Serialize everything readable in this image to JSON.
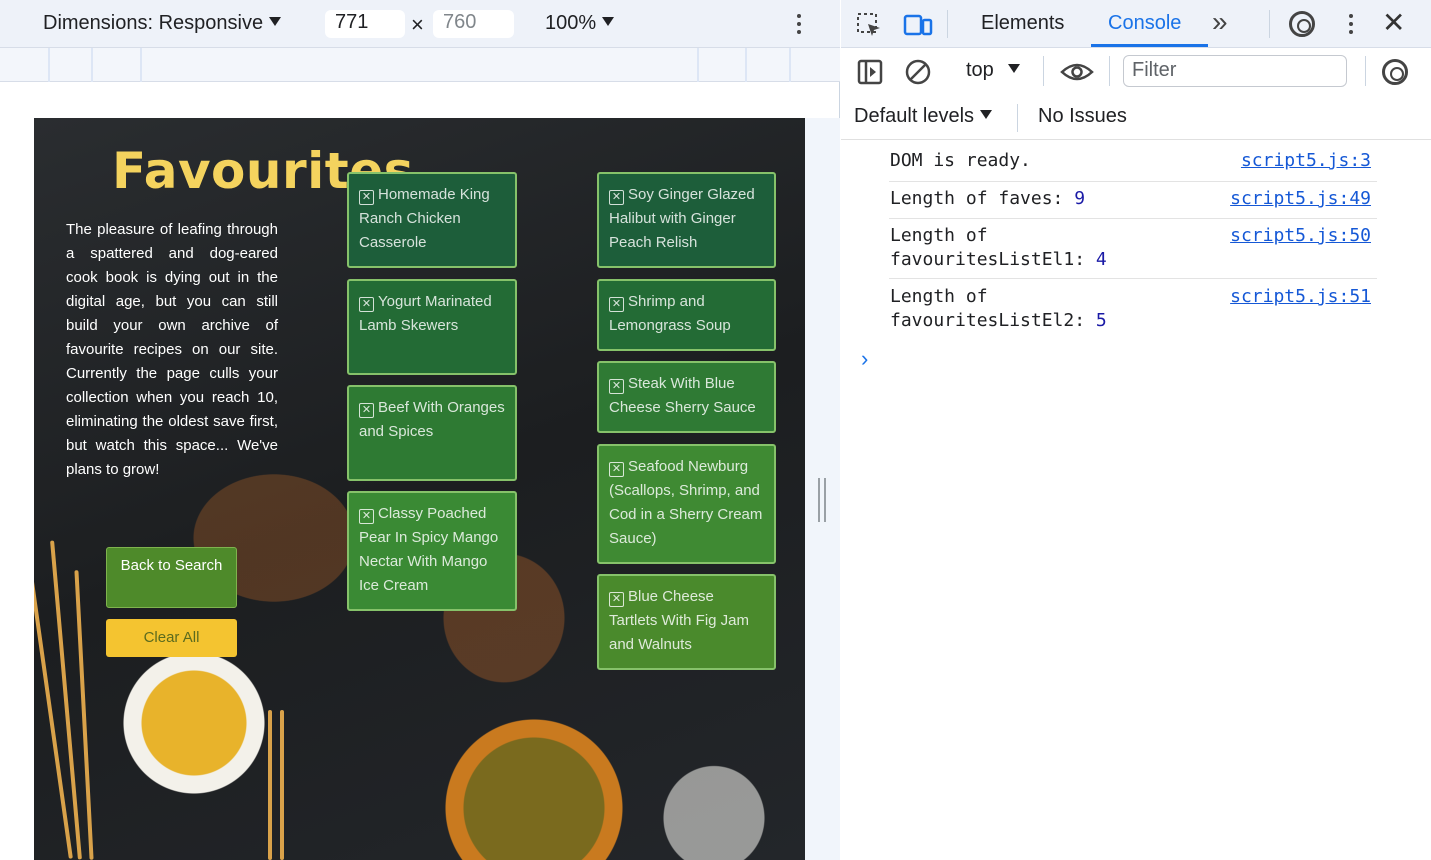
{
  "device_toolbar": {
    "dimensions_label": "Dimensions: Responsive",
    "width_value": "771",
    "height_value": "760",
    "times_sign": "×",
    "zoom_label": "100%"
  },
  "page": {
    "title": "Favourites",
    "intro": "The pleasure of leafing through a spattered and dog-eared cook book is dying out in the digital age, but you can still build your own archive of favourite recipes on our site. Currently the page culls your collection when you reach 10, eliminating the oldest save first, but watch this space... We've plans to grow!",
    "back_button": "Back to Search",
    "clear_button": "Clear All",
    "remove_glyph": "✕",
    "favourites_col1": [
      "Homemade King Ranch Chicken Casserole",
      "Yogurt Marinated Lamb Skewers",
      "Beef With Oranges and Spices",
      "Classy Poached Pear In Spicy Mango Nectar With Mango Ice Cream"
    ],
    "favourites_col2": [
      "Soy Ginger Glazed Halibut with Ginger Peach Relish",
      "Shrimp and Lemongrass Soup",
      "Steak With Blue Cheese Sherry Sauce",
      "Seafood Newburg (Scallops, Shrimp, and Cod in a Sherry Cream Sauce)",
      "Blue Cheese Tartlets With Fig Jam and Walnuts"
    ]
  },
  "devtools": {
    "tabs": {
      "elements": "Elements",
      "console": "Console",
      "more": "»"
    },
    "context": "top",
    "filter_placeholder": "Filter",
    "levels": "Default levels",
    "issues": "No Issues",
    "logs": [
      {
        "text": "DOM is ready.",
        "source": "script5.js:3"
      },
      {
        "text": "Length of faves:",
        "value": "9",
        "source": "script5.js:49"
      },
      {
        "text1": "Length of",
        "text2": "favouritesListEl1:",
        "value": "4",
        "source": "script5.js:50"
      },
      {
        "text1": "Length of",
        "text2": "favouritesListEl2:",
        "value": "5",
        "source": "script5.js:51"
      }
    ],
    "prompt": "›"
  }
}
